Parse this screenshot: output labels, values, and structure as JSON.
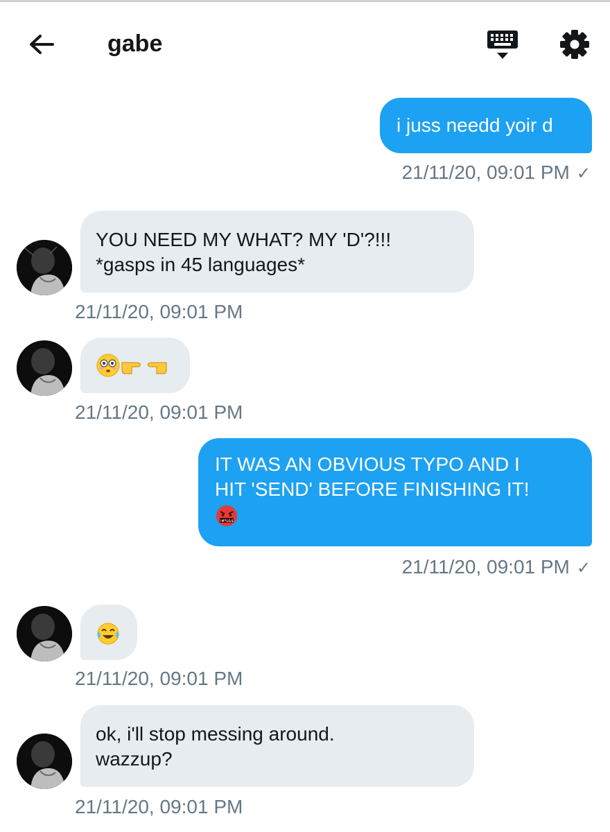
{
  "header": {
    "title": "gabe",
    "back_icon": "arrow-left-icon",
    "keyboard_icon": "keyboard-icon",
    "settings_icon": "gear-icon"
  },
  "colors": {
    "outgoing_bubble": "#1da1f2",
    "incoming_bubble": "#e6ecf0",
    "timestamp": "#657786"
  },
  "messages": [
    {
      "direction": "outgoing",
      "text": "i juss needd yoir d",
      "timestamp": "21/11/20, 09:01 PM",
      "status": "✓"
    },
    {
      "direction": "incoming",
      "line1": "YOU NEED MY WHAT? MY 'D'?!!!",
      "line2": "*gasps in 45 languages*",
      "timestamp": "21/11/20, 09:01 PM"
    },
    {
      "direction": "incoming",
      "emoji": [
        "flushed-face",
        "backhand-index-pointing-right",
        "backhand-index-pointing-left"
      ],
      "timestamp": "21/11/20, 09:01 PM"
    },
    {
      "direction": "outgoing",
      "line1": "IT WAS AN OBVIOUS TYPO AND I",
      "line2": "HIT 'SEND' BEFORE FINISHING IT!",
      "emoji": [
        "face-with-symbols-on-mouth"
      ],
      "timestamp": "21/11/20, 09:01 PM",
      "status": "✓"
    },
    {
      "direction": "incoming",
      "emoji": [
        "face-with-tears-of-joy"
      ],
      "timestamp": "21/11/20, 09:01 PM"
    },
    {
      "direction": "incoming",
      "line1": "ok, i'll stop messing around.",
      "line2": "wazzup?",
      "timestamp": "21/11/20, 09:01 PM"
    }
  ]
}
